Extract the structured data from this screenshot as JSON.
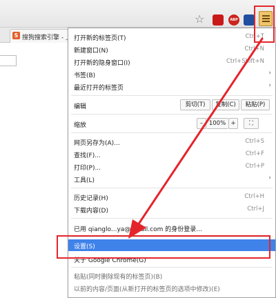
{
  "toolbar": {
    "bookmark_star": "☆",
    "abp_label": "ABP"
  },
  "tab": {
    "title": "搜狗搜索引擎 - 上..."
  },
  "menu": {
    "new_tab": {
      "label": "打开新的标签页(T)",
      "shortcut": "Ctrl+T"
    },
    "new_window": {
      "label": "新建窗口(N)",
      "shortcut": "Ctrl+N"
    },
    "incognito": {
      "label": "打开新的隐身窗口(I)",
      "shortcut": "Ctrl+Shift+N"
    },
    "bookmarks": {
      "label": "书签(B)"
    },
    "recent_tabs": {
      "label": "最近打开的标签页"
    },
    "edit": {
      "label": "编辑",
      "cut": "剪切(T)",
      "copy": "复制(C)",
      "paste": "粘贴(P)"
    },
    "zoom": {
      "label": "缩放",
      "minus": "–",
      "value": "100%",
      "plus": "+",
      "fullscreen": "⛶"
    },
    "save_as": {
      "label": "网页另存为(A)...",
      "shortcut": "Ctrl+S"
    },
    "find": {
      "label": "查找(F)...",
      "shortcut": "Ctrl+F"
    },
    "print": {
      "label": "打印(P)...",
      "shortcut": "Ctrl+P"
    },
    "tools": {
      "label": "工具(L)"
    },
    "history": {
      "label": "历史记录(H)",
      "shortcut": "Ctrl+H"
    },
    "downloads": {
      "label": "下载内容(D)",
      "shortcut": "Ctrl+J"
    },
    "signed_in": {
      "label": "已用 qianglo...ya@gmail.com 的身份登录..."
    },
    "settings": {
      "label": "设置(S)"
    },
    "about": {
      "label": "关于 Google Chrome(G)"
    },
    "extra1": {
      "label": "粘贴(同时删除现有的标签页)(B)"
    },
    "extra2": {
      "label": "以前的内容/页面(从新打开的标签页的选项中修改)(E)"
    }
  },
  "colors": {
    "highlight": "#3f82ea",
    "annotation_red": "#e3252b"
  }
}
